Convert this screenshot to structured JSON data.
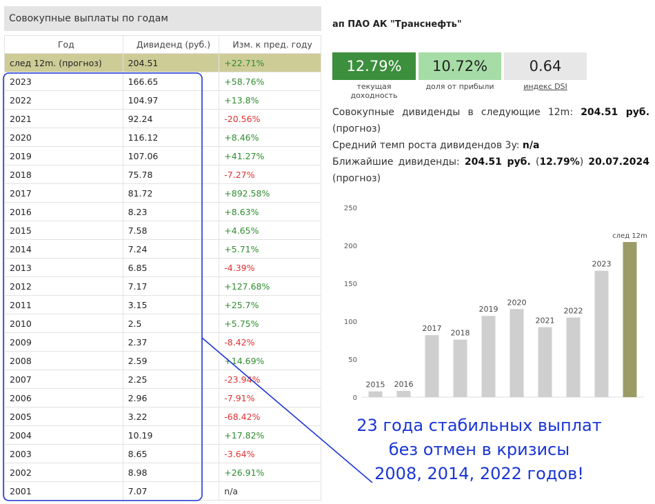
{
  "panel_title": "Совокупные выплаты по годам",
  "table": {
    "headers": [
      "Год",
      "Дивиденд (руб.)",
      "Изм. к пред. году"
    ],
    "forecast_row": {
      "year": "след 12m. (прогноз)",
      "dividend": "204.51",
      "change": "+22.71%"
    },
    "rows": [
      {
        "year": "2023",
        "dividend": "166.65",
        "change": "+58.76%"
      },
      {
        "year": "2022",
        "dividend": "104.97",
        "change": "+13.8%"
      },
      {
        "year": "2021",
        "dividend": "92.24",
        "change": "-20.56%"
      },
      {
        "year": "2020",
        "dividend": "116.12",
        "change": "+8.46%"
      },
      {
        "year": "2019",
        "dividend": "107.06",
        "change": "+41.27%"
      },
      {
        "year": "2018",
        "dividend": "75.78",
        "change": "-7.27%"
      },
      {
        "year": "2017",
        "dividend": "81.72",
        "change": "+892.58%"
      },
      {
        "year": "2016",
        "dividend": "8.23",
        "change": "+8.63%"
      },
      {
        "year": "2015",
        "dividend": "7.58",
        "change": "+4.65%"
      },
      {
        "year": "2014",
        "dividend": "7.24",
        "change": "+5.71%"
      },
      {
        "year": "2013",
        "dividend": "6.85",
        "change": "-4.39%"
      },
      {
        "year": "2012",
        "dividend": "7.17",
        "change": "+127.68%"
      },
      {
        "year": "2011",
        "dividend": "3.15",
        "change": "+25.7%"
      },
      {
        "year": "2010",
        "dividend": "2.5",
        "change": "+5.75%"
      },
      {
        "year": "2009",
        "dividend": "2.37",
        "change": "-8.42%"
      },
      {
        "year": "2008",
        "dividend": "2.59",
        "change": "+14.69%"
      },
      {
        "year": "2007",
        "dividend": "2.25",
        "change": "-23.94%"
      },
      {
        "year": "2006",
        "dividend": "2.96",
        "change": "-7.91%"
      },
      {
        "year": "2005",
        "dividend": "3.22",
        "change": "-68.42%"
      },
      {
        "year": "2004",
        "dividend": "10.19",
        "change": "+17.82%"
      },
      {
        "year": "2003",
        "dividend": "8.65",
        "change": "-3.64%"
      },
      {
        "year": "2002",
        "dividend": "8.98",
        "change": "+26.91%"
      },
      {
        "year": "2001",
        "dividend": "7.07",
        "change": "n/a"
      }
    ]
  },
  "company": "ап ПАО АК \"Транснефть\"",
  "metrics": [
    {
      "value": "12.79%",
      "label": "текущая доходность"
    },
    {
      "value": "10.72%",
      "label": "доля от прибыли"
    },
    {
      "value": "0.64",
      "label": "индекс DSI"
    }
  ],
  "info": {
    "next12_prefix": "Совокупные дивиденды в следующие 12m:",
    "next12_value": "204.51 руб.",
    "next12_suffix": "(прогноз)",
    "growth_prefix": "Средний темп роста дивидендов 3y:",
    "growth_value": "n/a",
    "nearest_prefix": "Ближайшие дивиденды:",
    "nearest_value": "204.51 руб.",
    "nearest_yield": "12.79%",
    "nearest_date": "20.07.2024",
    "nearest_suffix": "(прогноз)"
  },
  "chart_data": {
    "type": "bar",
    "categories": [
      "2015",
      "2016",
      "2017",
      "2018",
      "2019",
      "2020",
      "2021",
      "2022",
      "2023",
      "след 12m"
    ],
    "values": [
      7.58,
      8.23,
      81.72,
      75.78,
      107.06,
      116.12,
      92.24,
      104.97,
      166.65,
      204.51
    ],
    "ylim": [
      0,
      250
    ],
    "yticks": [
      "0",
      "50",
      "100",
      "150",
      "200",
      "250"
    ],
    "colors": {
      "bar": "#cfcfcf",
      "forecast_bar": "#9b9b66",
      "axis_text": "#555555"
    }
  },
  "annotation": {
    "lines": [
      "23 года стабильных выплат",
      "без отмен в кризисы",
      "2008, 2014, 2022 годов!"
    ],
    "color": "#1a35d6"
  }
}
